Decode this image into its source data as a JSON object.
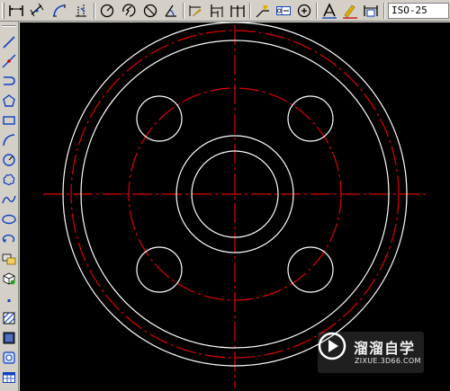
{
  "toolbar_top": {
    "buttons": [
      {
        "name": "dim-linear-icon"
      },
      {
        "name": "dim-aligned-icon"
      },
      {
        "name": "dim-arc-length-icon"
      },
      {
        "name": "dim-ordinate-icon"
      },
      {
        "name": "dim-radius-icon"
      },
      {
        "name": "dim-jogged-icon"
      },
      {
        "name": "dim-diameter-icon"
      },
      {
        "name": "dim-angular-icon"
      },
      {
        "name": "quick-dim-icon"
      },
      {
        "name": "dim-baseline-icon"
      },
      {
        "name": "dim-continue-icon"
      },
      {
        "name": "quick-leader-icon"
      },
      {
        "name": "tolerance-icon"
      },
      {
        "name": "center-mark-icon"
      },
      {
        "name": "dim-edit-icon"
      },
      {
        "name": "dim-text-edit-icon"
      },
      {
        "name": "dim-update-icon"
      }
    ],
    "dim_style": "ISO-25"
  },
  "toolbar_left": {
    "buttons": [
      {
        "name": "line-icon"
      },
      {
        "name": "construction-line-icon"
      },
      {
        "name": "polyline-icon"
      },
      {
        "name": "polygon-icon"
      },
      {
        "name": "rectangle-icon"
      },
      {
        "name": "arc-icon"
      },
      {
        "name": "circle-icon"
      },
      {
        "name": "revision-cloud-icon"
      },
      {
        "name": "spline-icon"
      },
      {
        "name": "ellipse-icon"
      },
      {
        "name": "ellipse-arc-icon"
      },
      {
        "name": "insert-block-icon"
      },
      {
        "name": "make-block-icon"
      },
      {
        "name": "point-icon"
      },
      {
        "name": "hatch-icon"
      },
      {
        "name": "gradient-icon"
      },
      {
        "name": "region-icon"
      },
      {
        "name": "table-icon"
      }
    ]
  },
  "colors": {
    "canvas_bg": "#000000",
    "object_line": "#ffffff",
    "center_line": "#e00000"
  },
  "watermark": {
    "title": "溜溜自学",
    "url": "ZIXUE.3D66.COM"
  }
}
